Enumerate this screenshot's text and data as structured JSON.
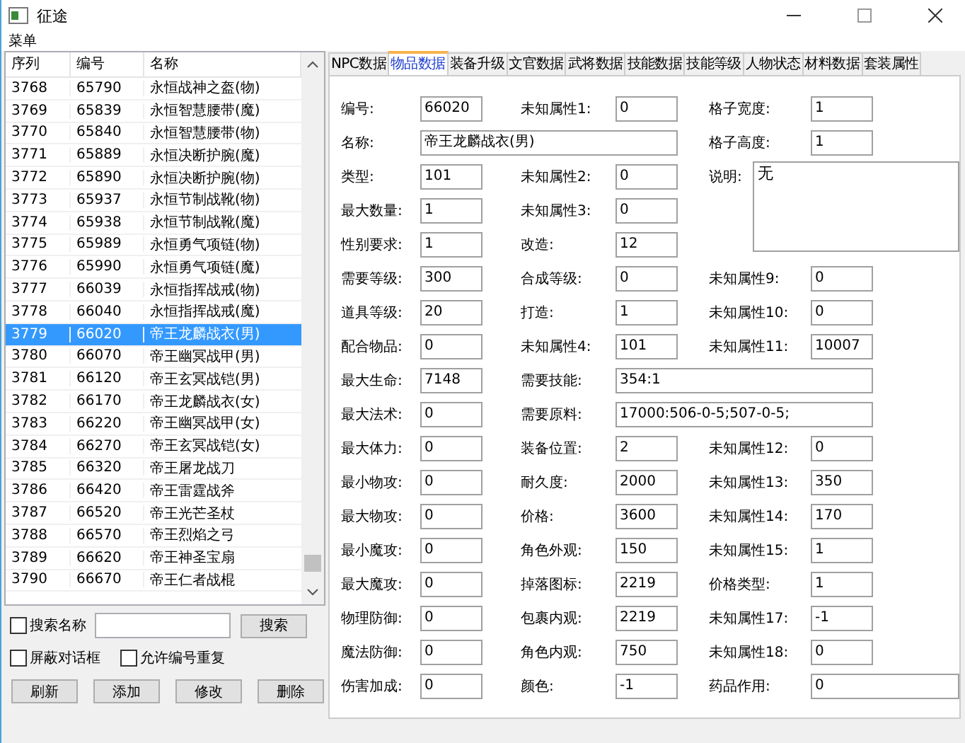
{
  "window": {
    "title": "征途"
  },
  "menu": [
    "菜单"
  ],
  "list": {
    "columns": [
      "序列",
      "编号",
      "名称"
    ],
    "rows": [
      {
        "cells": [
          "3768",
          "65790",
          "永恒战神之盔(物)"
        ],
        "selected": false
      },
      {
        "cells": [
          "3769",
          "65839",
          "永恒智慧腰带(魔)"
        ],
        "selected": false
      },
      {
        "cells": [
          "3770",
          "65840",
          "永恒智慧腰带(物)"
        ],
        "selected": false
      },
      {
        "cells": [
          "3771",
          "65889",
          "永恒决断护腕(魔)"
        ],
        "selected": false
      },
      {
        "cells": [
          "3772",
          "65890",
          "永恒决断护腕(物)"
        ],
        "selected": false
      },
      {
        "cells": [
          "3773",
          "65937",
          "永恒节制战靴(物)"
        ],
        "selected": false
      },
      {
        "cells": [
          "3774",
          "65938",
          "永恒节制战靴(魔)"
        ],
        "selected": false
      },
      {
        "cells": [
          "3775",
          "65989",
          "永恒勇气项链(物)"
        ],
        "selected": false
      },
      {
        "cells": [
          "3776",
          "65990",
          "永恒勇气项链(魔)"
        ],
        "selected": false
      },
      {
        "cells": [
          "3777",
          "66039",
          "永恒指挥战戒(物)"
        ],
        "selected": false
      },
      {
        "cells": [
          "3778",
          "66040",
          "永恒指挥战戒(魔)"
        ],
        "selected": false
      },
      {
        "cells": [
          "3779",
          "66020",
          "帝王龙麟战衣(男)"
        ],
        "selected": true
      },
      {
        "cells": [
          "3780",
          "66070",
          "帝王幽冥战甲(男)"
        ],
        "selected": false
      },
      {
        "cells": [
          "3781",
          "66120",
          "帝王玄冥战铠(男)"
        ],
        "selected": false
      },
      {
        "cells": [
          "3782",
          "66170",
          "帝王龙麟战衣(女)"
        ],
        "selected": false
      },
      {
        "cells": [
          "3783",
          "66220",
          "帝王幽冥战甲(女)"
        ],
        "selected": false
      },
      {
        "cells": [
          "3784",
          "66270",
          "帝王玄冥战铠(女)"
        ],
        "selected": false
      },
      {
        "cells": [
          "3785",
          "66320",
          "帝王屠龙战刀"
        ],
        "selected": false
      },
      {
        "cells": [
          "3786",
          "66420",
          "帝王雷霆战斧"
        ],
        "selected": false
      },
      {
        "cells": [
          "3787",
          "66520",
          "帝王光芒圣杖"
        ],
        "selected": false
      },
      {
        "cells": [
          "3788",
          "66570",
          "帝王烈焰之弓"
        ],
        "selected": false
      },
      {
        "cells": [
          "3789",
          "66620",
          "帝王神圣宝扇"
        ],
        "selected": false
      },
      {
        "cells": [
          "3790",
          "66670",
          "帝王仁者战棍"
        ],
        "selected": false
      }
    ]
  },
  "search": {
    "checkbox": {
      "label": "搜索名称",
      "checked": false
    },
    "button": "搜索"
  },
  "options": [
    {
      "label": "屏蔽对话框",
      "checked": false
    },
    {
      "label": "允许编号重复",
      "checked": false
    }
  ],
  "buttons": [
    "刷新",
    "添加",
    "修改",
    "删除"
  ],
  "tabs": [
    {
      "label": "NPC数据",
      "selected": false
    },
    {
      "label": "物品数据",
      "selected": true
    },
    {
      "label": "装备升级",
      "selected": false
    },
    {
      "label": "文官数据",
      "selected": false
    },
    {
      "label": "武将数据",
      "selected": false
    },
    {
      "label": "技能数据",
      "selected": false
    },
    {
      "label": "技能等级",
      "selected": false
    },
    {
      "label": "人物状态",
      "selected": false
    },
    {
      "label": "材料数据",
      "selected": false
    },
    {
      "label": "套装属性",
      "selected": false
    }
  ],
  "form": [
    {
      "col1": {
        "label": "编号:",
        "value": "66020",
        "kind": "short"
      },
      "col2": {
        "label": "未知属性1:",
        "value": "0",
        "kind": "short"
      },
      "col3": {
        "label": "格子宽度:",
        "value": "1",
        "kind": "short"
      }
    },
    {
      "col1": {
        "label": "名称:",
        "value": "帝王龙麟战衣(男)",
        "kind": "wide"
      },
      "col3": {
        "label": "格子高度:",
        "value": "1",
        "kind": "short"
      }
    },
    {
      "col1": {
        "label": "类型:",
        "value": "101",
        "kind": "short"
      },
      "col2": {
        "label": "未知属性2:",
        "value": "0",
        "kind": "short"
      },
      "col3": {
        "label": "说明:",
        "value": "无",
        "kind": "memo"
      }
    },
    {
      "col1": {
        "label": "最大数量:",
        "value": "1",
        "kind": "short"
      },
      "col2": {
        "label": "未知属性3:",
        "value": "0",
        "kind": "short"
      }
    },
    {
      "col1": {
        "label": "性别要求:",
        "value": "1",
        "kind": "short"
      },
      "col2": {
        "label": "改造:",
        "value": "12",
        "kind": "short"
      }
    },
    {
      "col1": {
        "label": "需要等级:",
        "value": "300",
        "kind": "short"
      },
      "col2": {
        "label": "合成等级:",
        "value": "0",
        "kind": "short"
      },
      "col3": {
        "label": "未知属性9:",
        "value": "0",
        "kind": "short"
      }
    },
    {
      "col1": {
        "label": "道具等级:",
        "value": "20",
        "kind": "short"
      },
      "col2": {
        "label": "打造:",
        "value": "1",
        "kind": "short"
      },
      "col3": {
        "label": "未知属性10:",
        "value": "0",
        "kind": "short"
      }
    },
    {
      "col1": {
        "label": "配合物品:",
        "value": "0",
        "kind": "short"
      },
      "col2": {
        "label": "未知属性4:",
        "value": "101",
        "kind": "short"
      },
      "col3": {
        "label": "未知属性11:",
        "value": "10007",
        "kind": "short"
      }
    },
    {
      "col1": {
        "label": "最大生命:",
        "value": "7148",
        "kind": "short"
      },
      "col2": {
        "label": "需要技能:",
        "value": "354:1",
        "kind": "wide"
      }
    },
    {
      "col1": {
        "label": "最大法术:",
        "value": "0",
        "kind": "short"
      },
      "col2": {
        "label": "需要原料:",
        "value": "17000:506-0-5;507-0-5;",
        "kind": "wide"
      }
    },
    {
      "col1": {
        "label": "最大体力:",
        "value": "0",
        "kind": "short"
      },
      "col2": {
        "label": "装备位置:",
        "value": "2",
        "kind": "short"
      },
      "col3": {
        "label": "未知属性12:",
        "value": "0",
        "kind": "short"
      }
    },
    {
      "col1": {
        "label": "最小物攻:",
        "value": "0",
        "kind": "short"
      },
      "col2": {
        "label": "耐久度:",
        "value": "2000",
        "kind": "short"
      },
      "col3": {
        "label": "未知属性13:",
        "value": "350",
        "kind": "short"
      }
    },
    {
      "col1": {
        "label": "最大物攻:",
        "value": "0",
        "kind": "short"
      },
      "col2": {
        "label": "价格:",
        "value": "3600",
        "kind": "short"
      },
      "col3": {
        "label": "未知属性14:",
        "value": "170",
        "kind": "short"
      }
    },
    {
      "col1": {
        "label": "最小魔攻:",
        "value": "0",
        "kind": "short"
      },
      "col2": {
        "label": "角色外观:",
        "value": "150",
        "kind": "short"
      },
      "col3": {
        "label": "未知属性15:",
        "value": "1",
        "kind": "short"
      }
    },
    {
      "col1": {
        "label": "最大魔攻:",
        "value": "0",
        "kind": "short"
      },
      "col2": {
        "label": "掉落图标:",
        "value": "2219",
        "kind": "short"
      },
      "col3": {
        "label": "价格类型:",
        "value": "1",
        "kind": "short"
      }
    },
    {
      "col1": {
        "label": "物理防御:",
        "value": "0",
        "kind": "short"
      },
      "col2": {
        "label": "包裹内观:",
        "value": "2219",
        "kind": "short"
      },
      "col3": {
        "label": "未知属性17:",
        "value": "-1",
        "kind": "short"
      }
    },
    {
      "col1": {
        "label": "魔法防御:",
        "value": "0",
        "kind": "short"
      },
      "col2": {
        "label": "角色内观:",
        "value": "750",
        "kind": "short"
      },
      "col3": {
        "label": "未知属性18:",
        "value": "0",
        "kind": "short"
      }
    },
    {
      "col1": {
        "label": "伤害加成:",
        "value": "0",
        "kind": "short"
      },
      "col2": {
        "label": "颜色:",
        "value": "-1",
        "kind": "short"
      },
      "col3": {
        "label": "药品作用:",
        "value": "0",
        "kind": "long"
      }
    }
  ]
}
